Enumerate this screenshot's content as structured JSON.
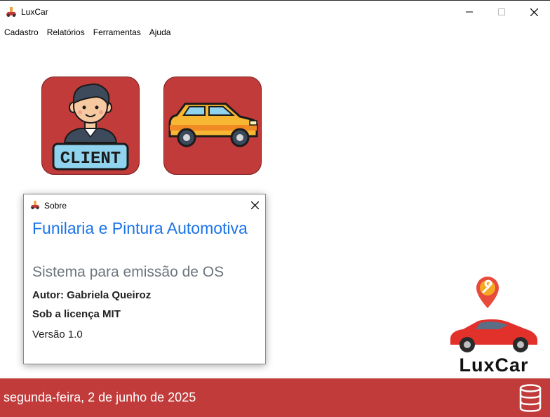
{
  "window": {
    "title": "LuxCar"
  },
  "menu": {
    "items": [
      "Cadastro",
      "Relatórios",
      "Ferramentas",
      "Ajuda"
    ]
  },
  "tiles": {
    "client_label": "CLIENT"
  },
  "about_dialog": {
    "title": "Sobre",
    "heading": "Funilaria e Pintura Automotiva",
    "subheading": "Sistema para emissão de OS",
    "author": "Autor: Gabriela Queiroz",
    "license": "Sob a licença MIT",
    "version": "Versão 1.0"
  },
  "logo": {
    "text": "LuxCar"
  },
  "status": {
    "date": "segunda-feira, 2 de junho de 2025"
  },
  "colors": {
    "accent": "#c13b3b",
    "heading": "#1a73e8",
    "subheading": "#6c757d"
  },
  "icons": [
    "app-car-icon",
    "minimize-icon",
    "maximize-icon",
    "close-icon",
    "client-icon",
    "car-icon",
    "wrench-pin-icon",
    "red-car-icon",
    "database-icon"
  ]
}
